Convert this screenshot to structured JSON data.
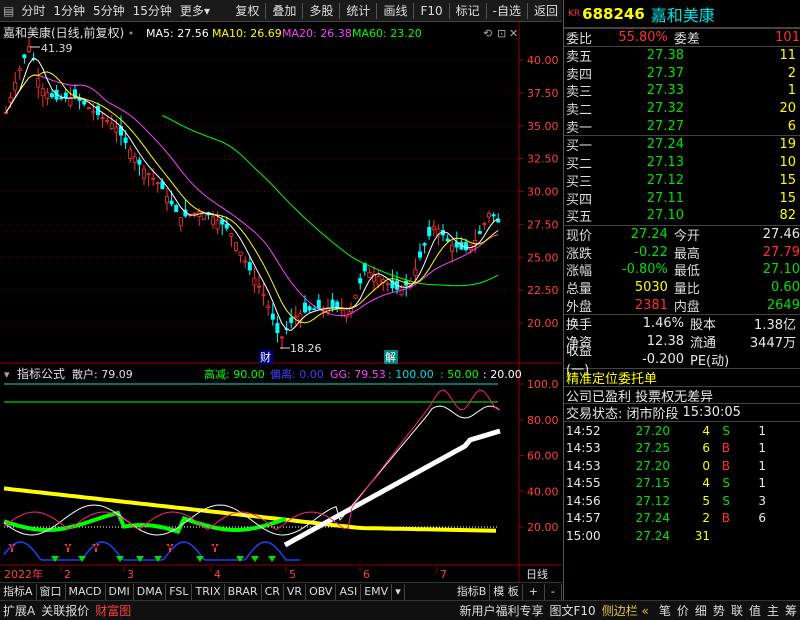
{
  "toolbar": {
    "items": [
      "分时",
      "1分钟",
      "5分钟",
      "15分钟",
      "更多"
    ],
    "more_arrow": "▾",
    "right_items": [
      "复权",
      "叠加",
      "多股",
      "统计",
      "画线",
      "F10",
      "标记",
      "-自选",
      "返回"
    ]
  },
  "main_chart": {
    "stock_label": "嘉和美康(日线,前复权)",
    "ma5": "MA5: 27.56",
    "ma10": "MA10: 26.69",
    "ma20": "MA20: 26.38",
    "ma60": "MA60: 23.20",
    "high_mark": "41.39",
    "low_mark": "18.26",
    "marker_cai": "财",
    "marker_jie": "解",
    "price_ticks": [
      "40.00",
      "37.50",
      "35.00",
      "32.50",
      "30.00",
      "27.50",
      "25.00",
      "22.50",
      "20.00"
    ],
    "colors": {
      "ma5": "#ffffff",
      "ma10": "#ffff00",
      "ma20": "#ff40ff",
      "ma60": "#00ff00"
    }
  },
  "sub_chart": {
    "title": "指标公式",
    "scatter": "散户: 79.09",
    "gaojian": "高减: 90.00",
    "pianli": "偏离: 0.00",
    "gg": "GG: 79.53",
    "v100": ": 100.00",
    "v50": ": 50.00",
    "v20": ": 20.00",
    "ticks": [
      "100.0",
      "80.00",
      "60.00",
      "40.00",
      "20.00"
    ]
  },
  "x_axis": {
    "year": "2022年",
    "months": [
      "2",
      "3",
      "4",
      "5",
      "6",
      "7"
    ],
    "right_label": "日线"
  },
  "indicator_tabs": [
    "指标A",
    "窗口",
    "MACD",
    "DMI",
    "DMA",
    "FSL",
    "TRIX",
    "BRAR",
    "CR",
    "VR",
    "OBV",
    "ASI",
    "EMV"
  ],
  "indicator_tabs_right": [
    "指标B",
    "模 板",
    "+",
    "-"
  ],
  "status_bar": {
    "left": [
      "扩展A",
      "关联报价",
      "财富图"
    ],
    "right": [
      "新用户福利专享",
      "图文F10",
      "侧边栏 «"
    ],
    "icons": [
      "笔",
      "价",
      "细",
      "势",
      "联",
      "值",
      "主",
      "筹"
    ]
  },
  "quote": {
    "kr": "KR",
    "code": "688246",
    "name": "嘉和美康",
    "weibi_label": "委比",
    "weibi": "55.80%",
    "weicha_label": "委差",
    "weicha": "101",
    "sell": [
      {
        "label": "卖五",
        "price": "27.38",
        "vol": "11"
      },
      {
        "label": "卖四",
        "price": "27.37",
        "vol": "2"
      },
      {
        "label": "卖三",
        "price": "27.33",
        "vol": "1"
      },
      {
        "label": "卖二",
        "price": "27.32",
        "vol": "20"
      },
      {
        "label": "卖一",
        "price": "27.27",
        "vol": "6"
      }
    ],
    "buy": [
      {
        "label": "买一",
        "price": "27.24",
        "vol": "19"
      },
      {
        "label": "买二",
        "price": "27.13",
        "vol": "10"
      },
      {
        "label": "买三",
        "price": "27.12",
        "vol": "15"
      },
      {
        "label": "买四",
        "price": "27.11",
        "vol": "15"
      },
      {
        "label": "买五",
        "price": "27.10",
        "vol": "82"
      }
    ],
    "stats": [
      {
        "l1": "现价",
        "v1": "27.24",
        "c1": "green",
        "l2": "今开",
        "v2": "27.46",
        "c2": "white"
      },
      {
        "l1": "涨跌",
        "v1": "-0.22",
        "c1": "green",
        "l2": "最高",
        "v2": "27.79",
        "c2": "red"
      },
      {
        "l1": "涨幅",
        "v1": "-0.80%",
        "c1": "green",
        "l2": "最低",
        "v2": "27.10",
        "c2": "green"
      },
      {
        "l1": "总量",
        "v1": "5030",
        "c1": "yellow",
        "l2": "量比",
        "v2": "0.60",
        "c2": "green"
      },
      {
        "l1": "外盘",
        "v1": "2381",
        "c1": "red",
        "l2": "内盘",
        "v2": "2649",
        "c2": "green"
      }
    ],
    "stats2": [
      {
        "l1": "换手",
        "v1": "1.46%",
        "l2": "股本",
        "v2": "1.38亿"
      },
      {
        "l1": "净资",
        "v1": "12.38",
        "l2": "流通",
        "v2": "3447万"
      },
      {
        "l1": "收益(一)",
        "v1": "-0.200",
        "l2": "PE(动)",
        "v2": ""
      }
    ],
    "notice1": "精准定位委托单",
    "notice2": "公司已盈利 投票权无差异",
    "status_label": "交易状态: 闭市阶段",
    "status_time": "15:30:05",
    "trades": [
      {
        "time": "14:52",
        "price": "27.20",
        "vol": "4",
        "side": "S"
      },
      {
        "time": "14:53",
        "price": "27.25",
        "vol": "6",
        "side": "B"
      },
      {
        "time": "14:53",
        "price": "27.20",
        "vol": "0",
        "side": "B"
      },
      {
        "time": "14:55",
        "price": "27.15",
        "vol": "4",
        "side": "S"
      },
      {
        "time": "14:56",
        "price": "27.12",
        "vol": "5",
        "side": "S"
      },
      {
        "time": "14:57",
        "price": "27.24",
        "vol": "2",
        "side": "B"
      },
      {
        "time": "15:00",
        "price": "27.24",
        "vol": "31",
        "side": ""
      }
    ],
    "trade_counts": [
      "1",
      "1",
      "1",
      "1",
      "3",
      "6",
      ""
    ]
  }
}
